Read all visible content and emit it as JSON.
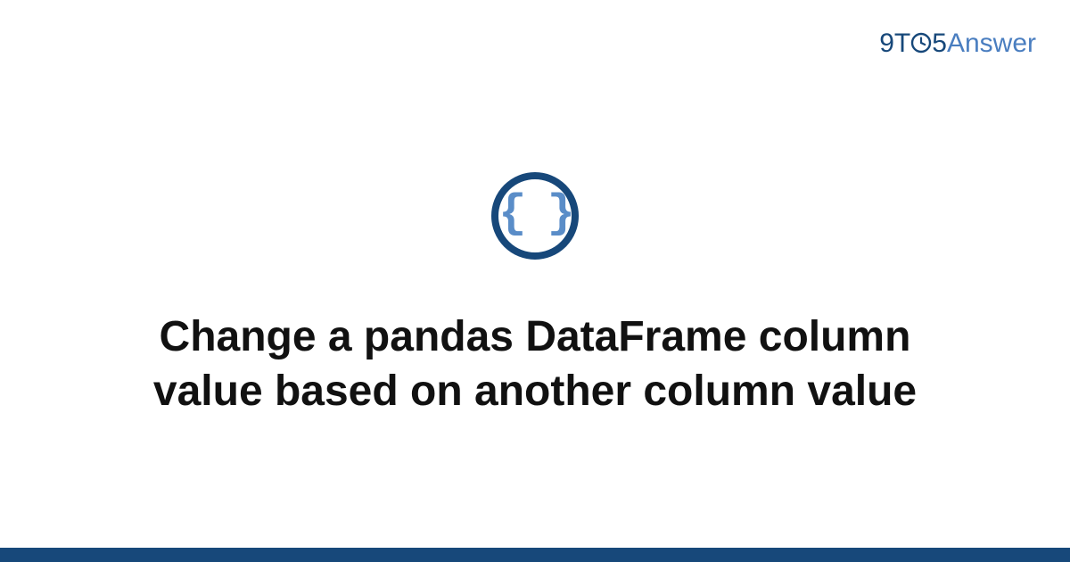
{
  "brand": {
    "part1": "9T",
    "part2": "5",
    "part3": "Answer"
  },
  "icon": {
    "symbol": "{ }"
  },
  "title": "Change a pandas DataFrame column value based on another column value"
}
